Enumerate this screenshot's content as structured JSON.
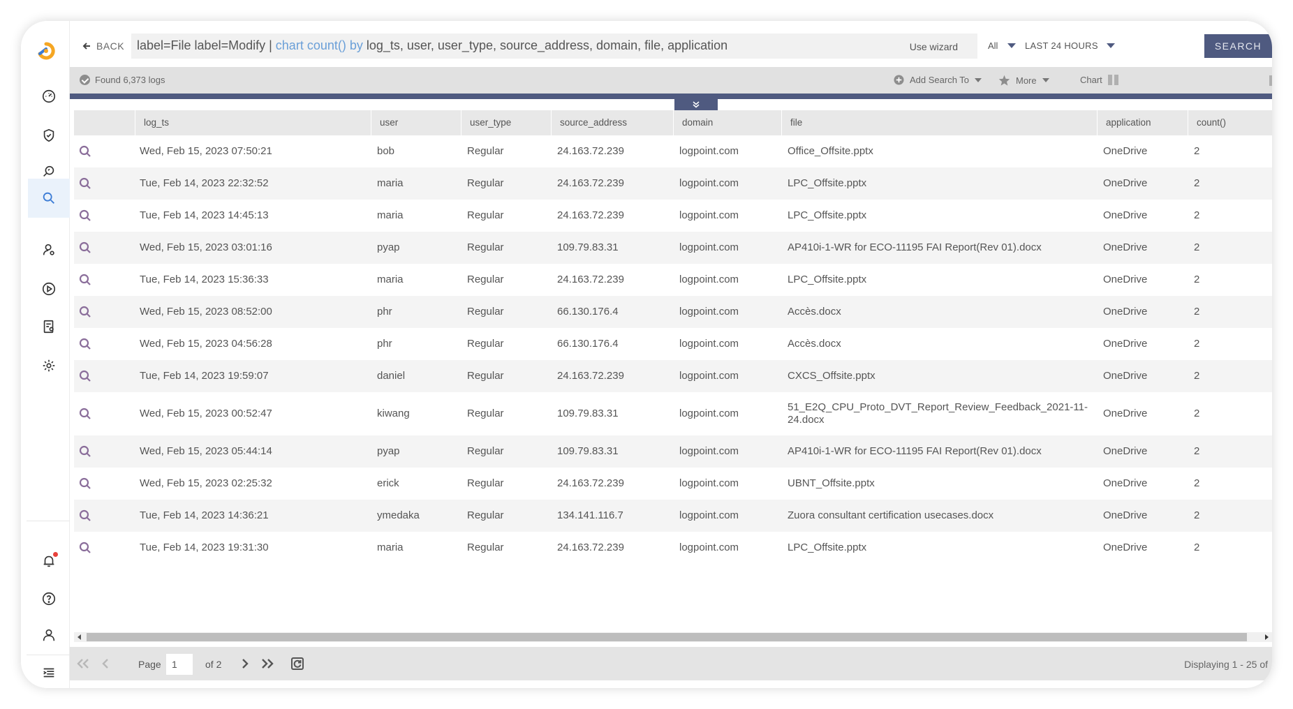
{
  "nav": {
    "back_label": "BACK",
    "items": [
      {
        "name": "dashboard"
      },
      {
        "name": "incidents"
      },
      {
        "name": "investigate"
      },
      {
        "name": "search"
      },
      {
        "name": "identities"
      },
      {
        "name": "playbooks"
      },
      {
        "name": "reports"
      },
      {
        "name": "settings"
      }
    ]
  },
  "query": {
    "part1": "label=File label=Modify | ",
    "kw1": "chart count()",
    "kw2": " by",
    "part2": " log_ts, user, user_type, source_address, domain, file, application"
  },
  "toolbar": {
    "use_wizard": "Use wizard",
    "repo_filter": "All",
    "time_range": "LAST 24 HOURS",
    "search_label": "SEARCH"
  },
  "status": {
    "found": "Found 6,373 logs",
    "add_search_to": "Add Search To",
    "more": "More",
    "chart": "Chart"
  },
  "table": {
    "headers": [
      "log_ts",
      "user",
      "user_type",
      "source_address",
      "domain",
      "file",
      "application",
      "count()"
    ],
    "rows": [
      {
        "log_ts": "Wed, Feb 15, 2023 07:50:21",
        "user": "bob",
        "user_type": "Regular",
        "source_address": "24.163.72.239",
        "domain": "logpoint.com",
        "file": "Office_Offsite.pptx",
        "application": "OneDrive",
        "count": "2"
      },
      {
        "log_ts": "Tue, Feb 14, 2023 22:32:52",
        "user": "maria",
        "user_type": "Regular",
        "source_address": "24.163.72.239",
        "domain": "logpoint.com",
        "file": "LPC_Offsite.pptx",
        "application": "OneDrive",
        "count": "2"
      },
      {
        "log_ts": "Tue, Feb 14, 2023 14:45:13",
        "user": "maria",
        "user_type": "Regular",
        "source_address": "24.163.72.239",
        "domain": "logpoint.com",
        "file": "LPC_Offsite.pptx",
        "application": "OneDrive",
        "count": "2"
      },
      {
        "log_ts": "Wed, Feb 15, 2023 03:01:16",
        "user": "pyap",
        "user_type": "Regular",
        "source_address": "109.79.83.31",
        "domain": "logpoint.com",
        "file": "AP410i-1-WR for ECO-11195 FAI Report(Rev 01).docx",
        "application": "OneDrive",
        "count": "2"
      },
      {
        "log_ts": "Tue, Feb 14, 2023 15:36:33",
        "user": "maria",
        "user_type": "Regular",
        "source_address": "24.163.72.239",
        "domain": "logpoint.com",
        "file": "LPC_Offsite.pptx",
        "application": "OneDrive",
        "count": "2"
      },
      {
        "log_ts": "Wed, Feb 15, 2023 08:52:00",
        "user": "phr",
        "user_type": "Regular",
        "source_address": "66.130.176.4",
        "domain": "logpoint.com",
        "file": "Accès.docx",
        "application": "OneDrive",
        "count": "2"
      },
      {
        "log_ts": "Wed, Feb 15, 2023 04:56:28",
        "user": "phr",
        "user_type": "Regular",
        "source_address": "66.130.176.4",
        "domain": "logpoint.com",
        "file": "Accès.docx",
        "application": "OneDrive",
        "count": "2"
      },
      {
        "log_ts": "Tue, Feb 14, 2023 19:59:07",
        "user": "daniel",
        "user_type": "Regular",
        "source_address": "24.163.72.239",
        "domain": "logpoint.com",
        "file": "CXCS_Offsite.pptx",
        "application": "OneDrive",
        "count": "2"
      },
      {
        "log_ts": "Wed, Feb 15, 2023 00:52:47",
        "user": "kiwang",
        "user_type": "Regular",
        "source_address": "109.79.83.31",
        "domain": "logpoint.com",
        "file": "51_E2Q_CPU_Proto_DVT_Report_Review_Feedback_2021-11-24.docx",
        "application": "OneDrive",
        "count": "2"
      },
      {
        "log_ts": "Wed, Feb 15, 2023 05:44:14",
        "user": "pyap",
        "user_type": "Regular",
        "source_address": "109.79.83.31",
        "domain": "logpoint.com",
        "file": "AP410i-1-WR for ECO-11195 FAI Report(Rev 01).docx",
        "application": "OneDrive",
        "count": "2"
      },
      {
        "log_ts": "Wed, Feb 15, 2023 02:25:32",
        "user": "erick",
        "user_type": "Regular",
        "source_address": "24.163.72.239",
        "domain": "logpoint.com",
        "file": "UBNT_Offsite.pptx",
        "application": "OneDrive",
        "count": "2"
      },
      {
        "log_ts": "Tue, Feb 14, 2023 14:36:21",
        "user": "ymedaka",
        "user_type": "Regular",
        "source_address": "134.141.116.7",
        "domain": "logpoint.com",
        "file": "Zuora consultant certification usecases.docx",
        "application": "OneDrive",
        "count": "2"
      },
      {
        "log_ts": "Tue, Feb 14, 2023 19:31:30",
        "user": "maria",
        "user_type": "Regular",
        "source_address": "24.163.72.239",
        "domain": "logpoint.com",
        "file": "LPC_Offsite.pptx",
        "application": "OneDrive",
        "count": "2"
      }
    ]
  },
  "pager": {
    "page_label": "Page",
    "page_value": "1",
    "of_label": "of 2",
    "displaying": "Displaying 1 - 25 of"
  },
  "colors": {
    "accent": "#4f5a80",
    "query_keyword": "#6a9fd8",
    "row_icon": "#8a6d9a",
    "logo_orange": "#f5a623",
    "logo_blue": "#3a7bd5",
    "notification": "#e8413b"
  }
}
